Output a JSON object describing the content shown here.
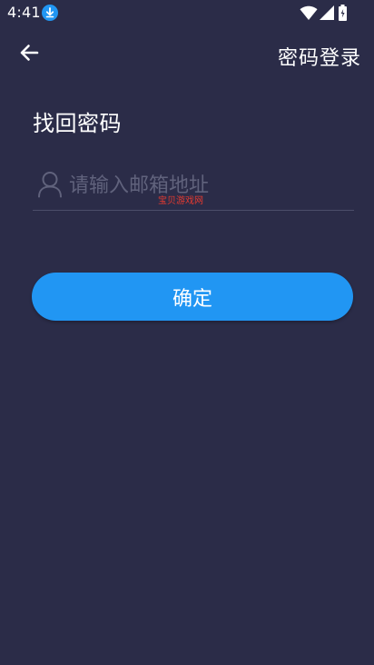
{
  "status_bar": {
    "time": "4:41",
    "icons": [
      "download-icon",
      "wifi-icon",
      "cell-signal-icon",
      "battery-icon"
    ]
  },
  "toolbar": {
    "back_icon": "arrow-left-icon",
    "right_action_label": "密码登录"
  },
  "page": {
    "title": "找回密码"
  },
  "email_field": {
    "icon": "user-icon",
    "value": "",
    "placeholder": "请输入邮箱地址"
  },
  "watermark": "宝贝游戏网",
  "confirm_button": {
    "label": "确定"
  },
  "colors": {
    "background": "#2b2c48",
    "accent": "#2196f3",
    "placeholder": "#60627c",
    "divider": "#4b4d6a",
    "download_badge": "#2196f3",
    "watermark": "#e53a30"
  }
}
